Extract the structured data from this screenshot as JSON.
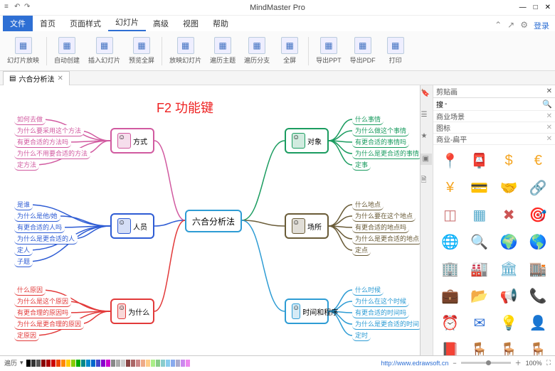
{
  "title": "MindMaster Pro",
  "menu": {
    "file": "文件",
    "items": [
      "首页",
      "页面样式",
      "幻灯片",
      "高级",
      "视图",
      "帮助"
    ],
    "active": 3,
    "login": "登录"
  },
  "ribbon": [
    {
      "id": "slideshow",
      "label": "幻灯片放映"
    },
    {
      "id": "auto",
      "label": "自动创建"
    },
    {
      "id": "insert",
      "label": "插入幻灯片"
    },
    {
      "id": "preview",
      "label": "预览全屏"
    },
    {
      "id": "style",
      "label": "放映幻灯片"
    },
    {
      "id": "traverse",
      "label": "遍历主题"
    },
    {
      "id": "branch",
      "label": "遍历分支"
    },
    {
      "id": "full",
      "label": "全屏"
    },
    {
      "id": "ppt",
      "label": "导出PPT"
    },
    {
      "id": "pdf",
      "label": "导出PDF"
    },
    {
      "id": "print",
      "label": "打印"
    }
  ],
  "fileTab": "六合分析法",
  "annot": "F2 功能键",
  "mm": {
    "center": "六合分析法",
    "left": [
      {
        "title": "方式",
        "color": "#d15aa0",
        "leaves": [
          "如何去做",
          "为什么要采用这个方法",
          "有更合适的方法吗",
          "为什么不用要合适的方法",
          "定方法"
        ]
      },
      {
        "title": "人员",
        "color": "#2e5cd4",
        "leaves": [
          "是谁",
          "为什么是他/她",
          "有更合适的人吗",
          "为什么是更合适的人",
          "定人",
          "子题"
        ]
      },
      {
        "title": "为什么",
        "color": "#e23a3a",
        "leaves": [
          "什么原因",
          "为什么是这个原因",
          "有更合理的原因吗",
          "为什么是更合理的原因",
          "定原因"
        ]
      }
    ],
    "right": [
      {
        "title": "对象",
        "color": "#1b9c60",
        "leaves": [
          "什么事情",
          "为什么做这个事情",
          "有更合适的事情吗",
          "为什么是更合适的事情",
          "定事"
        ]
      },
      {
        "title": "场所",
        "color": "#6a5c38",
        "leaves": [
          "什么地点",
          "为什么要在这个地点",
          "有更合适的地点吗",
          "为什么是更合适的地点",
          "定点"
        ]
      },
      {
        "title": "时间和程序",
        "color": "#2e9cd4",
        "leaves": [
          "什么时候",
          "为什么在这个时候",
          "有更合适的时间吗",
          "为什么是更合适的时间",
          "定时"
        ]
      }
    ]
  },
  "panel": {
    "title": "剪贴画",
    "search": "搜",
    "cats": [
      "商业场景",
      "图标",
      "商业-扁平"
    ]
  },
  "status": {
    "left": "遍历",
    "zoom": "100%",
    "url": "http://www.edrawsoft.cn"
  },
  "palette": [
    "#000",
    "#333",
    "#555",
    "#800",
    "#a00",
    "#c00",
    "#e40",
    "#f80",
    "#fc0",
    "#8c0",
    "#0a0",
    "#088",
    "#08c",
    "#06c",
    "#44c",
    "#80c",
    "#c0c",
    "#888",
    "#aaa",
    "#ccc",
    "#844",
    "#a66",
    "#c88",
    "#ea8",
    "#fc8",
    "#ae8",
    "#8c8",
    "#8cc",
    "#8ce",
    "#8ae",
    "#aac",
    "#c8e",
    "#e8e"
  ]
}
